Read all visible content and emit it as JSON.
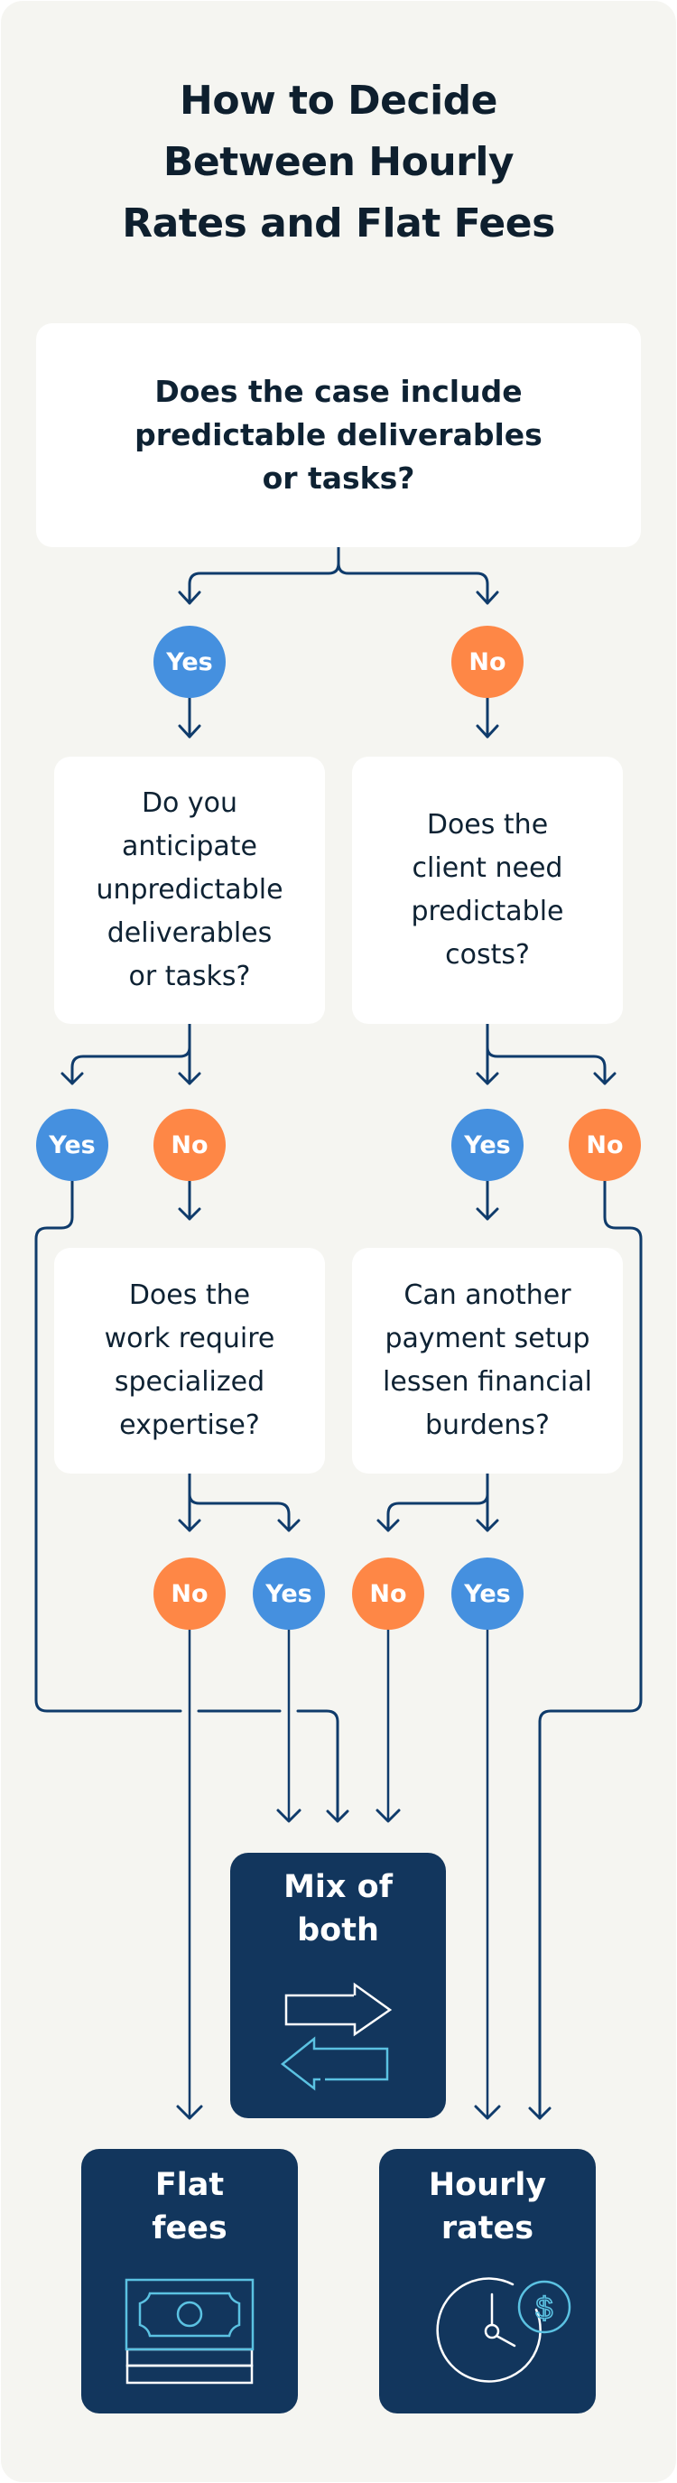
{
  "title": "How to Decide\nBetween Hourly\nRates and Flat Fees",
  "colors": {
    "background": "#f5f5f1",
    "yes": "#4590df",
    "no": "#fe8746",
    "result_box": "#12365d",
    "connector": "#0f3b6b",
    "icon_accent": "#5bc2e2"
  },
  "questions": {
    "q1": "Does the case include\npredictable deliverables\nor tasks?",
    "q2_yes": "Do you\nanticipate\nunpredictable\ndeliverables\nor tasks?",
    "q2_no": "Does the\nclient need\npredictable\ncosts?",
    "q3_expertise": "Does the\nwork require\nspecialized\nexpertise?",
    "q3_payment": "Can another\npayment setup\nlessen financial\nburdens?"
  },
  "answers": {
    "q1_yes": "Yes",
    "q1_no": "No",
    "q2a_yes": "Yes",
    "q2a_no": "No",
    "q2b_yes": "Yes",
    "q2b_no": "No",
    "q3a_no": "No",
    "q3a_yes": "Yes",
    "q3b_no": "No",
    "q3b_yes": "Yes"
  },
  "outcomes": {
    "mix": "Mix of\nboth",
    "flat": "Flat\nfees",
    "hourly": "Hourly\nrates"
  },
  "flows": [
    {
      "from": "q1",
      "answer": "Yes",
      "to": "q2_yes"
    },
    {
      "from": "q1",
      "answer": "No",
      "to": "q2_no"
    },
    {
      "from": "q2_yes",
      "answer": "Yes",
      "to": "mix"
    },
    {
      "from": "q2_yes",
      "answer": "No",
      "to": "q3_expertise"
    },
    {
      "from": "q2_no",
      "answer": "Yes",
      "to": "q3_payment"
    },
    {
      "from": "q2_no",
      "answer": "No",
      "to": "hourly"
    },
    {
      "from": "q3_expertise",
      "answer": "No",
      "to": "flat"
    },
    {
      "from": "q3_expertise",
      "answer": "Yes",
      "to": "mix"
    },
    {
      "from": "q3_payment",
      "answer": "No",
      "to": "mix"
    },
    {
      "from": "q3_payment",
      "answer": "Yes",
      "to": "hourly"
    }
  ],
  "icons": {
    "mix": "swap-arrows-icon",
    "flat": "cash-stack-icon",
    "hourly": "clock-dollar-icon"
  }
}
